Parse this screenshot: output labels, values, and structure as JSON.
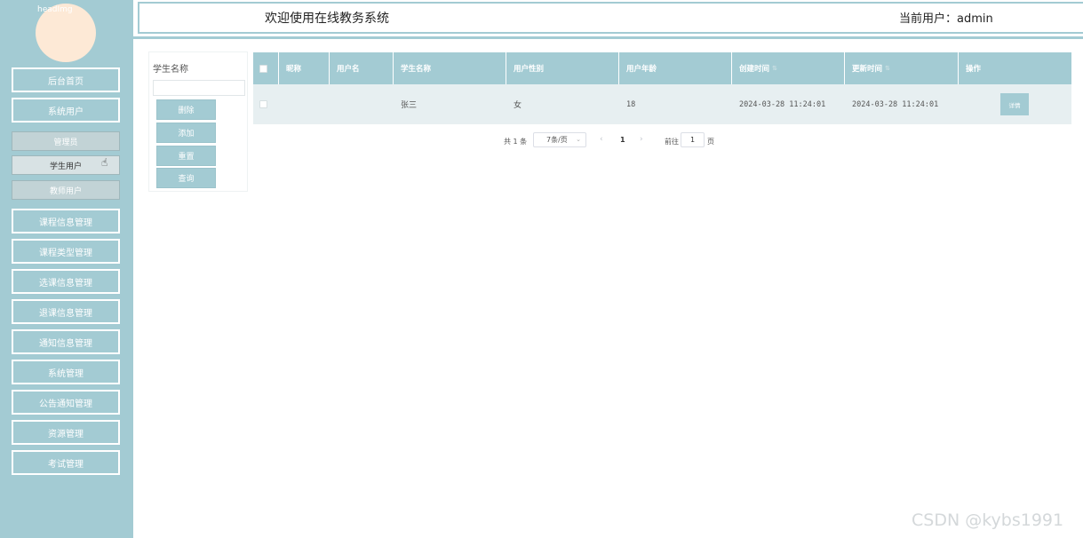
{
  "sidebar": {
    "avatar_alt": "headImg",
    "items": [
      {
        "label": "后台首页"
      },
      {
        "label": "系统用户"
      },
      {
        "label": "课程信息管理"
      },
      {
        "label": "课程类型管理"
      },
      {
        "label": "选课信息管理"
      },
      {
        "label": "退课信息管理"
      },
      {
        "label": "通知信息管理"
      },
      {
        "label": "系统管理"
      },
      {
        "label": "公告通知管理"
      },
      {
        "label": "资源管理"
      },
      {
        "label": "考试管理"
      }
    ],
    "subitems": [
      {
        "label": "管理员"
      },
      {
        "label": "学生用户"
      },
      {
        "label": "教师用户"
      }
    ]
  },
  "header": {
    "title": "欢迎使用在线教务系统",
    "user_label": "当前用户：admin"
  },
  "search": {
    "label": "学生名称",
    "value": "",
    "buttons": {
      "delete": "删除",
      "add": "添加",
      "reset": "重置",
      "query": "查询"
    }
  },
  "table": {
    "columns": [
      "昵称",
      "用户名",
      "学生名称",
      "用户性别",
      "用户年龄",
      "创建时间",
      "更新时间",
      "操作"
    ],
    "rows": [
      {
        "nickname": "",
        "username": "",
        "student_name": "张三",
        "gender": "女",
        "age": "18",
        "created": "2024-03-28 11:24:01",
        "updated": "2024-03-28 11:24:01",
        "action": "详情"
      }
    ]
  },
  "pagination": {
    "total": "共 1 条",
    "page_size": "7条/页",
    "current": "1",
    "goto_label": "前往",
    "goto_value": "1",
    "page_suffix": "页"
  },
  "watermark": "CSDN @kybs1991",
  "colors": {
    "accent": "#a3cbd3",
    "row_bg": "#e7eff1",
    "avatar": "#fde9d6"
  }
}
